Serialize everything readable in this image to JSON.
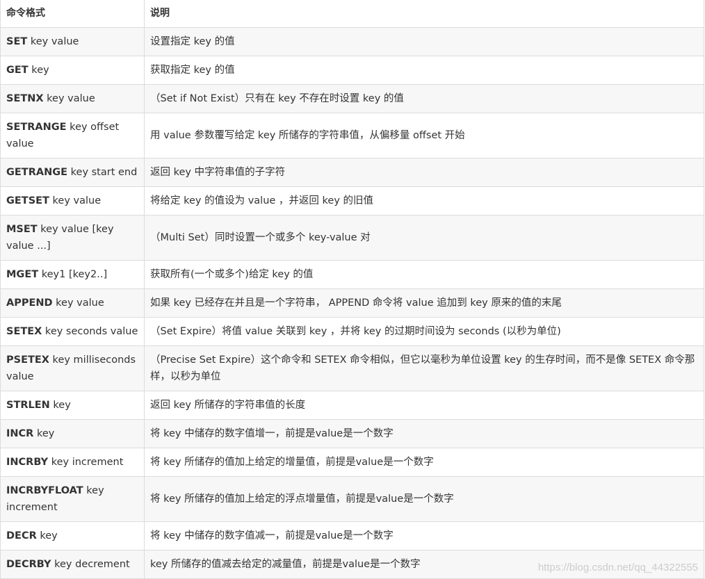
{
  "header": {
    "col1": "命令格式",
    "col2": "说明"
  },
  "rows": [
    {
      "cmd": "SET",
      "args": " key value",
      "desc": "设置指定 key 的值"
    },
    {
      "cmd": "GET",
      "args": " key",
      "desc": "获取指定 key 的值"
    },
    {
      "cmd": "SETNX",
      "args": " key value",
      "desc": "（Set if Not Exist）只有在 key 不存在时设置 key 的值"
    },
    {
      "cmd": "SETRANGE",
      "args": " key offset value",
      "desc": "用 value 参数覆写给定 key 所储存的字符串值，从偏移量 offset 开始"
    },
    {
      "cmd": "GETRANGE",
      "args": " key start end",
      "desc": "返回 key 中字符串值的子字符"
    },
    {
      "cmd": "GETSET",
      "args": " key value",
      "desc": "将给定 key 的值设为 value ，并返回 key 的旧值"
    },
    {
      "cmd": "MSET",
      "args": " key value [key value ...]",
      "desc": "（Multi Set）同时设置一个或多个 key-value 对"
    },
    {
      "cmd": "MGET",
      "args": " key1 [key2..]",
      "desc": "获取所有(一个或多个)给定 key 的值"
    },
    {
      "cmd": "APPEND",
      "args": " key value",
      "desc": "如果 key 已经存在并且是一个字符串， APPEND 命令将 value 追加到 key 原来的值的末尾"
    },
    {
      "cmd": "SETEX",
      "args": " key seconds value",
      "desc": "（Set Expire）将值 value 关联到 key ，并将 key 的过期时间设为 seconds (以秒为单位)"
    },
    {
      "cmd": "PSETEX",
      "args": " key milliseconds value",
      "desc": "（Precise Set Expire）这个命令和 SETEX 命令相似，但它以毫秒为单位设置 key 的生存时间，而不是像 SETEX 命令那样，以秒为单位"
    },
    {
      "cmd": "STRLEN",
      "args": " key",
      "desc": "返回 key 所储存的字符串值的长度"
    },
    {
      "cmd": "INCR",
      "args": " key",
      "desc": "将 key 中储存的数字值增一，前提是value是一个数字"
    },
    {
      "cmd": "INCRBY",
      "args": " key increment",
      "desc": "将 key 所储存的值加上给定的增量值，前提是value是一个数字"
    },
    {
      "cmd": "INCRBYFLOAT",
      "args": " key increment",
      "desc": "将 key 所储存的值加上给定的浮点增量值，前提是value是一个数字"
    },
    {
      "cmd": "DECR",
      "args": " key",
      "desc": "将 key 中储存的数字值减一，前提是value是一个数字"
    },
    {
      "cmd": "DECRBY",
      "args": " key decrement",
      "desc": "key 所储存的值减去给定的减量值，前提是value是一个数字"
    }
  ],
  "watermark": "https://blog.csdn.net/qq_44322555"
}
